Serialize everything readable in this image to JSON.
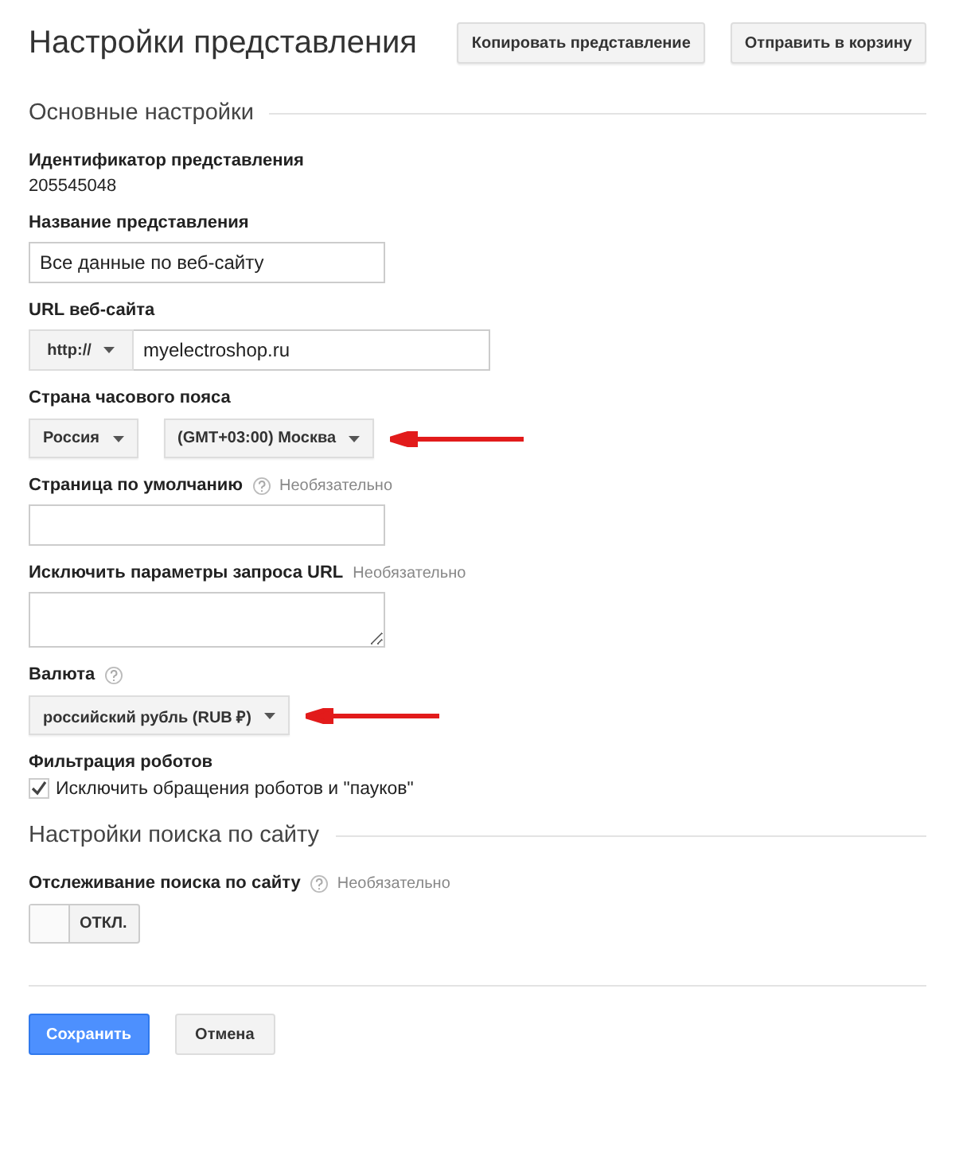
{
  "header": {
    "title": "Настройки представления",
    "buttons": [
      "Копировать представление",
      "Отправить в корзину"
    ]
  },
  "sections": [
    {
      "title": "Основные настройки",
      "fields": [
        {
          "kind": "static",
          "label": "Идентификатор представления",
          "value": "205545048"
        },
        {
          "kind": "text",
          "label": "Название представления",
          "value": "Все данные по веб-сайту"
        },
        {
          "kind": "url",
          "label": "URL веб-сайта",
          "protocol": "http://",
          "value": "myelectroshop.ru"
        },
        {
          "kind": "selects",
          "label": "Страна часового пояса",
          "options": [
            "Россия",
            "(GMT+03:00) Москва"
          ],
          "annotated": true
        },
        {
          "kind": "text",
          "label": "Страница по умолчанию",
          "help": true,
          "hint": "Необязательно"
        },
        {
          "kind": "textarea",
          "label": "Исключить параметры запроса URL",
          "hint": "Необязательно"
        },
        {
          "kind": "select",
          "label": "Валюта",
          "help": true,
          "options": [
            "российский рубль (RUB ₽)"
          ],
          "annotated": true
        },
        {
          "kind": "checkbox",
          "label": "Фильтрация роботов",
          "text": "Исключить обращения роботов и \"пауков\"",
          "checked": true
        }
      ]
    },
    {
      "title": "Настройки поиска по сайту",
      "fields": [
        {
          "kind": "toggle",
          "label": "Отслеживание поиска по сайту",
          "help": true,
          "hint": "Необязательно",
          "state_label": "ОТКЛ.",
          "on": false
        }
      ]
    }
  ],
  "footer_buttons": [
    {
      "label": "Сохранить",
      "primary": true
    },
    {
      "label": "Отмена",
      "primary": false
    }
  ]
}
